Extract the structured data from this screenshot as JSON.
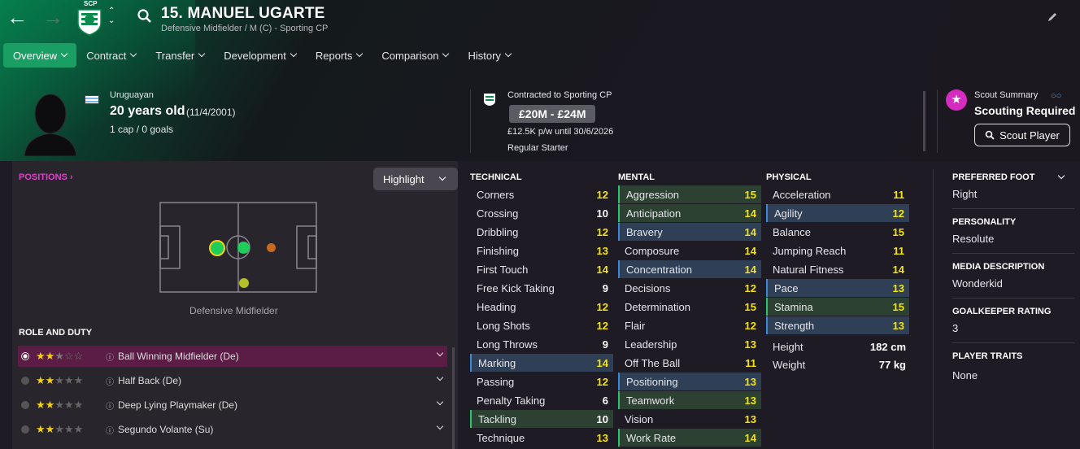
{
  "header": {
    "title": "15. MANUEL UGARTE",
    "subtitle": "Defensive Midfielder / M (C) - Sporting CP",
    "club_badge_text": "SCP"
  },
  "menu": [
    {
      "label": "Overview",
      "active": true
    },
    {
      "label": "Contract"
    },
    {
      "label": "Transfer"
    },
    {
      "label": "Development"
    },
    {
      "label": "Reports"
    },
    {
      "label": "Comparison"
    },
    {
      "label": "History"
    }
  ],
  "player": {
    "nationality": "Uruguayan",
    "age": "20 years old",
    "dob": "(11/4/2001)",
    "caps": "1 cap / 0 goals"
  },
  "contract": {
    "contracted_to": "Contracted to Sporting CP",
    "value": "£20M - £24M",
    "wage": "£12.5K p/w until 30/6/2026",
    "status": "Regular Starter"
  },
  "scout": {
    "summary_label": "Scout Summary",
    "status": "Scouting Required",
    "button": "Scout Player"
  },
  "positions": {
    "label": "POSITIONS",
    "highlight": "Highlight",
    "position_name": "Defensive Midfielder"
  },
  "role_and_duty": {
    "label": "ROLE AND DUTY",
    "roles": [
      {
        "name": "Ball Winning Midfielder (De)",
        "stars": 2.5,
        "selected": true
      },
      {
        "name": "Half Back (De)",
        "stars": 2,
        "selected": false
      },
      {
        "name": "Deep Lying Playmaker (De)",
        "stars": 2,
        "selected": false
      },
      {
        "name": "Segundo Volante (Su)",
        "stars": 2,
        "selected": false
      }
    ]
  },
  "technical": {
    "label": "TECHNICAL",
    "attrs": [
      {
        "name": "Corners",
        "value": "12",
        "hl": ""
      },
      {
        "name": "Crossing",
        "value": "10",
        "hl": ""
      },
      {
        "name": "Dribbling",
        "value": "12",
        "hl": ""
      },
      {
        "name": "Finishing",
        "value": "13",
        "hl": ""
      },
      {
        "name": "First Touch",
        "value": "14",
        "hl": ""
      },
      {
        "name": "Free Kick Taking",
        "value": "9",
        "hl": ""
      },
      {
        "name": "Heading",
        "value": "12",
        "hl": ""
      },
      {
        "name": "Long Shots",
        "value": "12",
        "hl": ""
      },
      {
        "name": "Long Throws",
        "value": "9",
        "hl": ""
      },
      {
        "name": "Marking",
        "value": "14",
        "hl": "blue"
      },
      {
        "name": "Passing",
        "value": "12",
        "hl": ""
      },
      {
        "name": "Penalty Taking",
        "value": "6",
        "hl": ""
      },
      {
        "name": "Tackling",
        "value": "10",
        "hl": "green"
      },
      {
        "name": "Technique",
        "value": "13",
        "hl": ""
      }
    ]
  },
  "mental": {
    "label": "MENTAL",
    "attrs": [
      {
        "name": "Aggression",
        "value": "15",
        "hl": "green"
      },
      {
        "name": "Anticipation",
        "value": "14",
        "hl": "green"
      },
      {
        "name": "Bravery",
        "value": "14",
        "hl": "blue"
      },
      {
        "name": "Composure",
        "value": "14",
        "hl": ""
      },
      {
        "name": "Concentration",
        "value": "14",
        "hl": "blue"
      },
      {
        "name": "Decisions",
        "value": "12",
        "hl": ""
      },
      {
        "name": "Determination",
        "value": "15",
        "hl": ""
      },
      {
        "name": "Flair",
        "value": "12",
        "hl": ""
      },
      {
        "name": "Leadership",
        "value": "13",
        "hl": ""
      },
      {
        "name": "Off The Ball",
        "value": "11",
        "hl": ""
      },
      {
        "name": "Positioning",
        "value": "13",
        "hl": "blue"
      },
      {
        "name": "Teamwork",
        "value": "13",
        "hl": "green"
      },
      {
        "name": "Vision",
        "value": "13",
        "hl": ""
      },
      {
        "name": "Work Rate",
        "value": "14",
        "hl": "green"
      }
    ]
  },
  "physical": {
    "label": "PHYSICAL",
    "attrs": [
      {
        "name": "Acceleration",
        "value": "11",
        "hl": ""
      },
      {
        "name": "Agility",
        "value": "12",
        "hl": "blue"
      },
      {
        "name": "Balance",
        "value": "15",
        "hl": ""
      },
      {
        "name": "Jumping Reach",
        "value": "11",
        "hl": ""
      },
      {
        "name": "Natural Fitness",
        "value": "14",
        "hl": ""
      },
      {
        "name": "Pace",
        "value": "13",
        "hl": "blue"
      },
      {
        "name": "Stamina",
        "value": "15",
        "hl": "green"
      },
      {
        "name": "Strength",
        "value": "13",
        "hl": "blue"
      }
    ],
    "height_label": "Height",
    "height": "182 cm",
    "weight_label": "Weight",
    "weight": "77 kg"
  },
  "profile": {
    "preferred_foot_label": "PREFERRED FOOT",
    "preferred_foot": "Right",
    "personality_label": "PERSONALITY",
    "personality": "Resolute",
    "media_label": "MEDIA DESCRIPTION",
    "media": "Wonderkid",
    "gk_label": "GOALKEEPER RATING",
    "gk": "3",
    "traits_label": "PLAYER TRAITS",
    "traits": "None"
  },
  "colors": {
    "accent_green": "#1a9e63",
    "attr_yellow": "#f5e30f",
    "highlight_blue": "#2f3f55",
    "highlight_green": "#2d4132",
    "role_selected": "#5b1d46",
    "positions_magenta": "#e040c8"
  }
}
